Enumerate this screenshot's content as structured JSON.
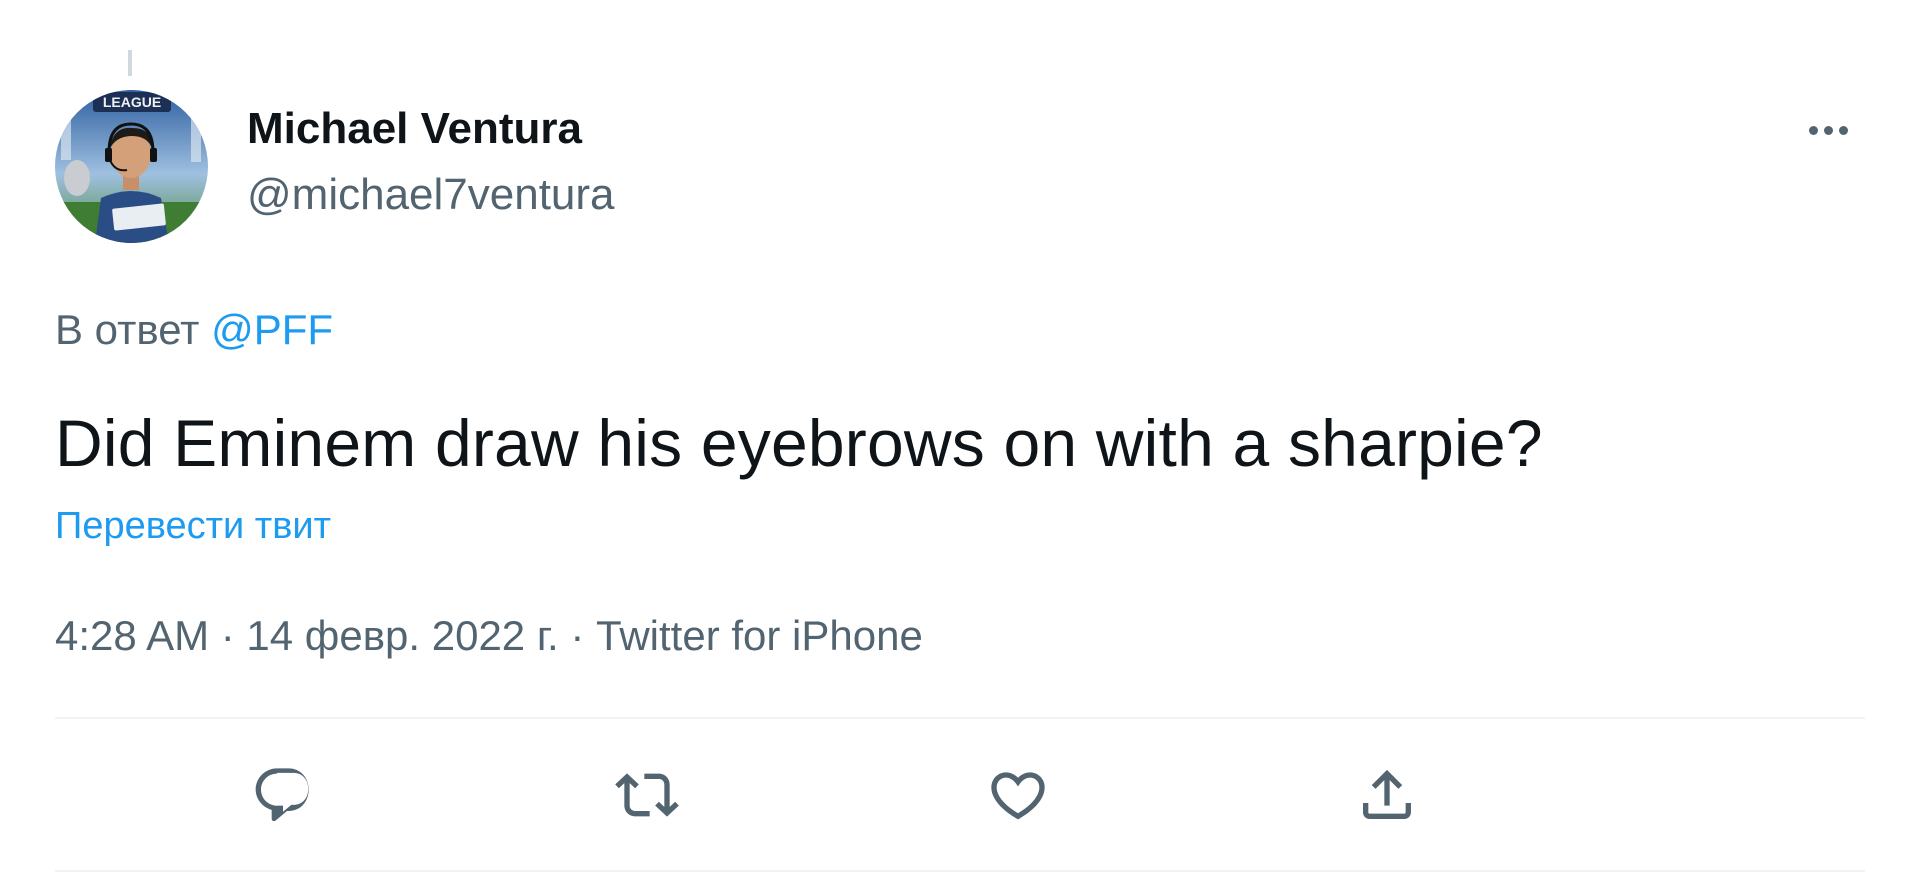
{
  "author": {
    "display_name": "Michael Ventura",
    "handle": "@michael7ventura",
    "avatar_icon": "user-avatar-photo",
    "avatar_badge_text": "LEAGUE"
  },
  "reply_context": {
    "prefix": "В ответ ",
    "mention": "@PFF"
  },
  "tweet": {
    "text": "Did Eminem draw his eyebrows on with a sharpie?",
    "translate_label": "Перевести твит"
  },
  "meta": {
    "line": "4:28 AM · 14 февр. 2022 г. · Twitter for iPhone"
  },
  "actions": [
    {
      "name": "reply",
      "icon": "reply-icon"
    },
    {
      "name": "retweet",
      "icon": "retweet-icon"
    },
    {
      "name": "like",
      "icon": "heart-icon"
    },
    {
      "name": "share",
      "icon": "share-icon"
    }
  ],
  "colors": {
    "accent": "#1d9bf0",
    "text_primary": "#0f1419",
    "text_secondary": "#536471",
    "divider": "#eff3f4"
  }
}
